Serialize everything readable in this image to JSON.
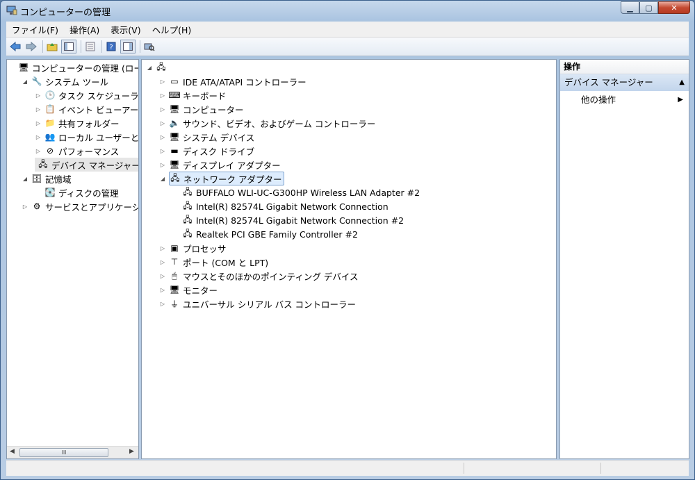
{
  "window": {
    "title": "コンピューターの管理"
  },
  "menu": [
    "ファイル(F)",
    "操作(A)",
    "表示(V)",
    "ヘルプ(H)"
  ],
  "left_tree": [
    {
      "label": "コンピューターの管理 (ローカ",
      "exp": "",
      "icon": "computer-management-icon",
      "glyph": "🖥",
      "indent": 0
    },
    {
      "label": "システム ツール",
      "exp": "◢",
      "icon": "tools-icon",
      "glyph": "🔧",
      "indent": 1
    },
    {
      "label": "タスク スケジューラ",
      "exp": "▷",
      "icon": "clock-icon",
      "glyph": "🕒",
      "indent": 2
    },
    {
      "label": "イベント ビューアー",
      "exp": "▷",
      "icon": "event-viewer-icon",
      "glyph": "📋",
      "indent": 2
    },
    {
      "label": "共有フォルダー",
      "exp": "▷",
      "icon": "shared-folder-icon",
      "glyph": "📁",
      "indent": 2
    },
    {
      "label": "ローカル ユーザーとグ",
      "exp": "▷",
      "icon": "users-icon",
      "glyph": "👥",
      "indent": 2
    },
    {
      "label": "パフォーマンス",
      "exp": "▷",
      "icon": "performance-icon",
      "glyph": "⊘",
      "indent": 2
    },
    {
      "label": "デバイス マネージャー",
      "exp": "",
      "icon": "device-manager-icon",
      "glyph": "🖧",
      "indent": 2,
      "selected": true
    },
    {
      "label": "記憶域",
      "exp": "◢",
      "icon": "storage-icon",
      "glyph": "🗄",
      "indent": 1
    },
    {
      "label": "ディスクの管理",
      "exp": "",
      "icon": "disk-management-icon",
      "glyph": "💽",
      "indent": 2
    },
    {
      "label": "サービスとアプリケーショ",
      "exp": "▷",
      "icon": "services-icon",
      "glyph": "⚙",
      "indent": 1
    }
  ],
  "left_scroll": {
    "thumb": "III"
  },
  "device_tree": [
    {
      "label": "",
      "exp": "◢",
      "icon": "computer-root-icon",
      "glyph": "🖧",
      "indent": 0
    },
    {
      "label": "IDE ATA/ATAPI コントローラー",
      "exp": "▷",
      "icon": "ide-controller-icon",
      "glyph": "▭",
      "indent": 1
    },
    {
      "label": "キーボード",
      "exp": "▷",
      "icon": "keyboard-icon",
      "glyph": "⌨",
      "indent": 1
    },
    {
      "label": "コンピューター",
      "exp": "▷",
      "icon": "computer-icon",
      "glyph": "🖥",
      "indent": 1
    },
    {
      "label": "サウンド、ビデオ、およびゲーム コントローラー",
      "exp": "▷",
      "icon": "speaker-icon",
      "glyph": "🔈",
      "indent": 1
    },
    {
      "label": "システム デバイス",
      "exp": "▷",
      "icon": "system-devices-icon",
      "glyph": "🖥",
      "indent": 1
    },
    {
      "label": "ディスク ドライブ",
      "exp": "▷",
      "icon": "disk-drive-icon",
      "glyph": "▬",
      "indent": 1
    },
    {
      "label": "ディスプレイ アダプター",
      "exp": "▷",
      "icon": "display-adapter-icon",
      "glyph": "🖥",
      "indent": 1
    },
    {
      "label": "ネットワーク アダプター",
      "exp": "◢",
      "icon": "network-adapter-icon",
      "glyph": "🖧",
      "indent": 1,
      "highlight": true
    },
    {
      "label": "BUFFALO WLI-UC-G300HP Wireless LAN Adapter #2",
      "exp": "",
      "icon": "network-card-icon",
      "glyph": "🖧",
      "indent": 2
    },
    {
      "label": "Intel(R) 82574L Gigabit Network Connection",
      "exp": "",
      "icon": "network-card-icon",
      "glyph": "🖧",
      "indent": 2
    },
    {
      "label": "Intel(R) 82574L Gigabit Network Connection #2",
      "exp": "",
      "icon": "network-card-icon",
      "glyph": "🖧",
      "indent": 2
    },
    {
      "label": "Realtek PCI GBE Family Controller #2",
      "exp": "",
      "icon": "network-card-icon",
      "glyph": "🖧",
      "indent": 2
    },
    {
      "label": "プロセッサ",
      "exp": "▷",
      "icon": "processor-icon",
      "glyph": "▣",
      "indent": 1
    },
    {
      "label": "ポート (COM と LPT)",
      "exp": "▷",
      "icon": "port-icon",
      "glyph": "⊤",
      "indent": 1
    },
    {
      "label": "マウスとそのほかのポインティング デバイス",
      "exp": "▷",
      "icon": "mouse-icon",
      "glyph": "🖱",
      "indent": 1
    },
    {
      "label": "モニター",
      "exp": "▷",
      "icon": "monitor-icon",
      "glyph": "🖥",
      "indent": 1
    },
    {
      "label": "ユニバーサル シリアル バス コントローラー",
      "exp": "▷",
      "icon": "usb-icon",
      "glyph": "⏚",
      "indent": 1
    }
  ],
  "actions": {
    "header": "操作",
    "section": "デバイス マネージャー",
    "item": "他の操作"
  },
  "colors": {
    "accent": "#c2d5ec",
    "selection": "#ddecfd"
  }
}
